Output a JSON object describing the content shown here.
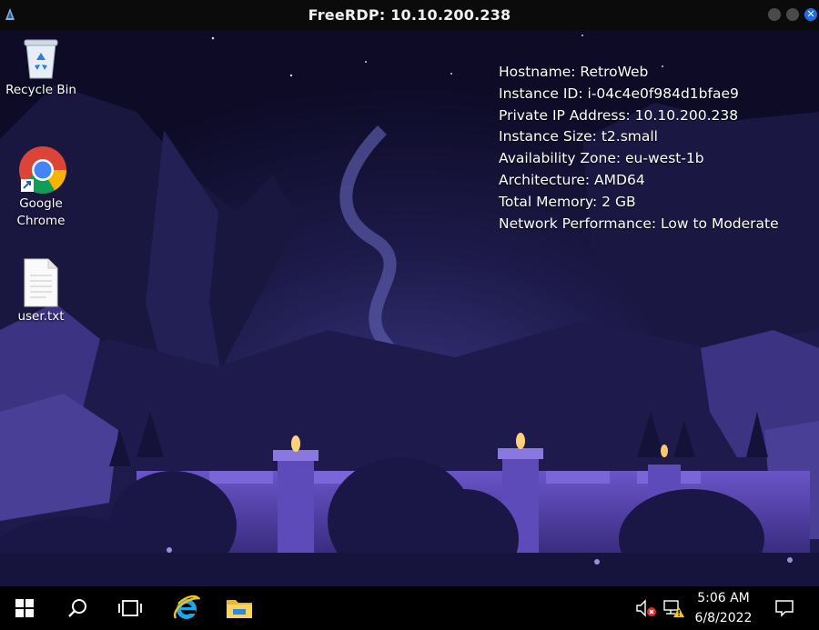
{
  "window": {
    "title": "FreeRDP: 10.10.200.238"
  },
  "desktop": {
    "icons": [
      {
        "label": "Recycle Bin",
        "icon": "recycle-bin-icon"
      },
      {
        "label": "Google Chrome",
        "label_line1": "Google",
        "label_line2": "Chrome",
        "icon": "chrome-icon"
      },
      {
        "label": "user.txt",
        "icon": "text-file-icon"
      }
    ]
  },
  "bginfo": {
    "hostname": "Hostname: RetroWeb",
    "instance_id": "Instance ID: i-04c4e0f984d1bfae9",
    "private_ip": "Private IP Address: 10.10.200.238",
    "instance_size": "Instance Size: t2.small",
    "availability_zone": "Availability Zone: eu-west-1b",
    "architecture": "Architecture: AMD64",
    "total_memory": "Total Memory: 2 GB",
    "network_performance": "Network Performance: Low to Moderate"
  },
  "taskbar": {
    "buttons": [
      "start-windows-icon",
      "search-icon",
      "task-view-icon",
      "internet-explorer-icon",
      "file-explorer-icon"
    ],
    "tray": {
      "time": "5:06 AM",
      "date": "6/8/2022",
      "icons": [
        "speaker-muted-icon",
        "network-warning-icon",
        "notifications-icon"
      ]
    }
  },
  "colors": {
    "sky": "#0d0b26",
    "accent": "#1f6fe0",
    "wall": "#4a3a9a"
  }
}
